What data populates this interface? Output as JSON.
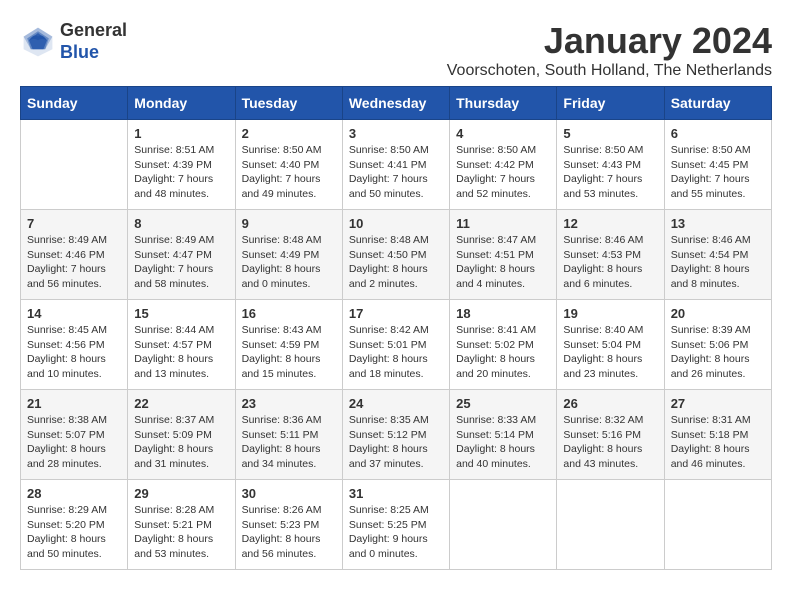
{
  "header": {
    "logo_general": "General",
    "logo_blue": "Blue",
    "month_title": "January 2024",
    "location": "Voorschoten, South Holland, The Netherlands"
  },
  "days_of_week": [
    "Sunday",
    "Monday",
    "Tuesday",
    "Wednesday",
    "Thursday",
    "Friday",
    "Saturday"
  ],
  "weeks": [
    [
      {
        "day": "",
        "info": ""
      },
      {
        "day": "1",
        "info": "Sunrise: 8:51 AM\nSunset: 4:39 PM\nDaylight: 7 hours\nand 48 minutes."
      },
      {
        "day": "2",
        "info": "Sunrise: 8:50 AM\nSunset: 4:40 PM\nDaylight: 7 hours\nand 49 minutes."
      },
      {
        "day": "3",
        "info": "Sunrise: 8:50 AM\nSunset: 4:41 PM\nDaylight: 7 hours\nand 50 minutes."
      },
      {
        "day": "4",
        "info": "Sunrise: 8:50 AM\nSunset: 4:42 PM\nDaylight: 7 hours\nand 52 minutes."
      },
      {
        "day": "5",
        "info": "Sunrise: 8:50 AM\nSunset: 4:43 PM\nDaylight: 7 hours\nand 53 minutes."
      },
      {
        "day": "6",
        "info": "Sunrise: 8:50 AM\nSunset: 4:45 PM\nDaylight: 7 hours\nand 55 minutes."
      }
    ],
    [
      {
        "day": "7",
        "info": "Sunrise: 8:49 AM\nSunset: 4:46 PM\nDaylight: 7 hours\nand 56 minutes."
      },
      {
        "day": "8",
        "info": "Sunrise: 8:49 AM\nSunset: 4:47 PM\nDaylight: 7 hours\nand 58 minutes."
      },
      {
        "day": "9",
        "info": "Sunrise: 8:48 AM\nSunset: 4:49 PM\nDaylight: 8 hours\nand 0 minutes."
      },
      {
        "day": "10",
        "info": "Sunrise: 8:48 AM\nSunset: 4:50 PM\nDaylight: 8 hours\nand 2 minutes."
      },
      {
        "day": "11",
        "info": "Sunrise: 8:47 AM\nSunset: 4:51 PM\nDaylight: 8 hours\nand 4 minutes."
      },
      {
        "day": "12",
        "info": "Sunrise: 8:46 AM\nSunset: 4:53 PM\nDaylight: 8 hours\nand 6 minutes."
      },
      {
        "day": "13",
        "info": "Sunrise: 8:46 AM\nSunset: 4:54 PM\nDaylight: 8 hours\nand 8 minutes."
      }
    ],
    [
      {
        "day": "14",
        "info": "Sunrise: 8:45 AM\nSunset: 4:56 PM\nDaylight: 8 hours\nand 10 minutes."
      },
      {
        "day": "15",
        "info": "Sunrise: 8:44 AM\nSunset: 4:57 PM\nDaylight: 8 hours\nand 13 minutes."
      },
      {
        "day": "16",
        "info": "Sunrise: 8:43 AM\nSunset: 4:59 PM\nDaylight: 8 hours\nand 15 minutes."
      },
      {
        "day": "17",
        "info": "Sunrise: 8:42 AM\nSunset: 5:01 PM\nDaylight: 8 hours\nand 18 minutes."
      },
      {
        "day": "18",
        "info": "Sunrise: 8:41 AM\nSunset: 5:02 PM\nDaylight: 8 hours\nand 20 minutes."
      },
      {
        "day": "19",
        "info": "Sunrise: 8:40 AM\nSunset: 5:04 PM\nDaylight: 8 hours\nand 23 minutes."
      },
      {
        "day": "20",
        "info": "Sunrise: 8:39 AM\nSunset: 5:06 PM\nDaylight: 8 hours\nand 26 minutes."
      }
    ],
    [
      {
        "day": "21",
        "info": "Sunrise: 8:38 AM\nSunset: 5:07 PM\nDaylight: 8 hours\nand 28 minutes."
      },
      {
        "day": "22",
        "info": "Sunrise: 8:37 AM\nSunset: 5:09 PM\nDaylight: 8 hours\nand 31 minutes."
      },
      {
        "day": "23",
        "info": "Sunrise: 8:36 AM\nSunset: 5:11 PM\nDaylight: 8 hours\nand 34 minutes."
      },
      {
        "day": "24",
        "info": "Sunrise: 8:35 AM\nSunset: 5:12 PM\nDaylight: 8 hours\nand 37 minutes."
      },
      {
        "day": "25",
        "info": "Sunrise: 8:33 AM\nSunset: 5:14 PM\nDaylight: 8 hours\nand 40 minutes."
      },
      {
        "day": "26",
        "info": "Sunrise: 8:32 AM\nSunset: 5:16 PM\nDaylight: 8 hours\nand 43 minutes."
      },
      {
        "day": "27",
        "info": "Sunrise: 8:31 AM\nSunset: 5:18 PM\nDaylight: 8 hours\nand 46 minutes."
      }
    ],
    [
      {
        "day": "28",
        "info": "Sunrise: 8:29 AM\nSunset: 5:20 PM\nDaylight: 8 hours\nand 50 minutes."
      },
      {
        "day": "29",
        "info": "Sunrise: 8:28 AM\nSunset: 5:21 PM\nDaylight: 8 hours\nand 53 minutes."
      },
      {
        "day": "30",
        "info": "Sunrise: 8:26 AM\nSunset: 5:23 PM\nDaylight: 8 hours\nand 56 minutes."
      },
      {
        "day": "31",
        "info": "Sunrise: 8:25 AM\nSunset: 5:25 PM\nDaylight: 9 hours\nand 0 minutes."
      },
      {
        "day": "",
        "info": ""
      },
      {
        "day": "",
        "info": ""
      },
      {
        "day": "",
        "info": ""
      }
    ]
  ]
}
